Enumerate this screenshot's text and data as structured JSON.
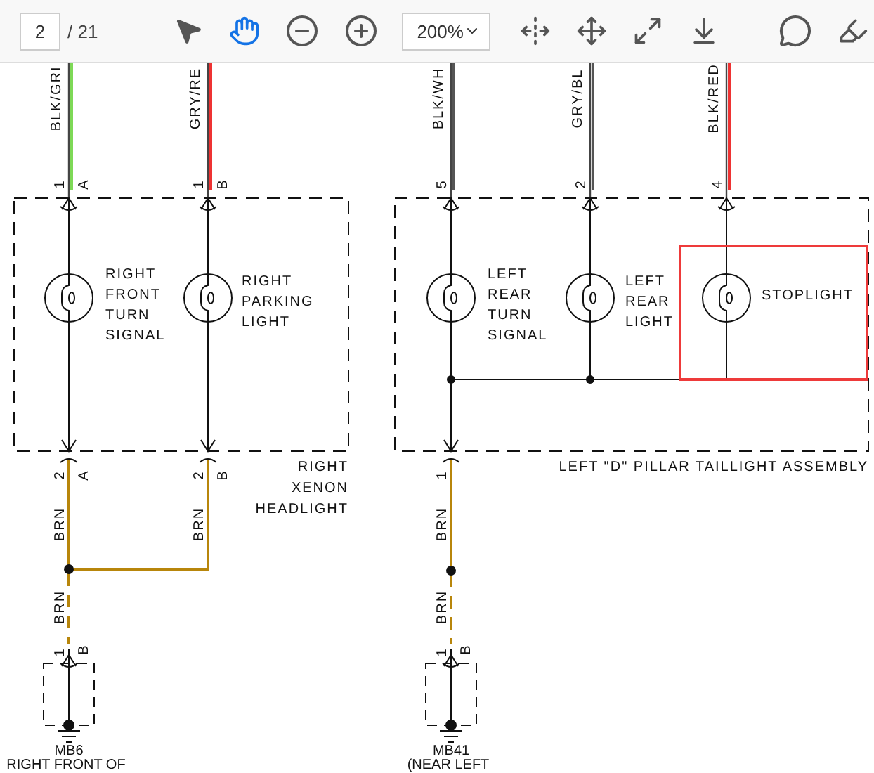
{
  "toolbar": {
    "page_field": "2",
    "page_count": "/ 21",
    "tools": [
      {
        "kind": "select",
        "selected": false
      },
      {
        "kind": "hand",
        "selected": true
      }
    ],
    "zoom": "200%"
  },
  "diagram": {
    "wires": [
      {
        "label": "BLK/GRI",
        "color": "#7ed957"
      },
      {
        "label": "GRY/RE",
        "color": "#ee3333"
      },
      {
        "label": "BLK/WH",
        "color": "#555555"
      },
      {
        "label": "GRY/BL",
        "color": "#555555"
      },
      {
        "label": "BLK/RED",
        "color": "#ee3333"
      }
    ],
    "pins": [
      "1",
      "A",
      "1",
      "B",
      "5",
      "2",
      "4",
      "2",
      "A",
      "2",
      "B",
      "1",
      "1",
      "B",
      "1",
      "B"
    ],
    "lamps": [
      [
        "RIGHT",
        "FRONT",
        "TURN",
        "SIGNAL"
      ],
      [
        "RIGHT",
        "PARKING",
        "LIGHT"
      ],
      [
        "LEFT",
        "REAR",
        "TURN",
        "SIGNAL"
      ],
      [
        "LEFT",
        "REAR",
        "LIGHT"
      ],
      [
        "STOPLIGHT"
      ]
    ],
    "ground_wire_labels": [
      "BRN",
      "BRN",
      "BRN",
      "BRN",
      "BRN"
    ],
    "assemblies": [
      [
        "RIGHT",
        "XENON",
        "HEADLIGHT"
      ],
      [
        "LEFT \"D\" PILLAR TAILLIGHT ASSEMBLY"
      ]
    ],
    "grounds": [
      {
        "code": "MB6",
        "location": "RIGHT FRONT OF"
      },
      {
        "code": "MB41",
        "location": "(NEAR LEFT"
      }
    ]
  }
}
